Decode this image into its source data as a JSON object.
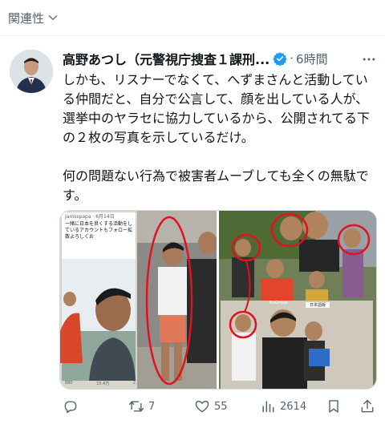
{
  "top": {
    "label": "関連性"
  },
  "tweet": {
    "author_name": "高野あつし（元警視庁捜査１課刑...",
    "time": "6時間",
    "separator": "·",
    "text_paragraph_1": "しかも、リスナーでなくて、へずまさんと活動している仲間だと、自分で公言して、顔を出している人が、選挙中のヤラセに協力しているから、公開されてる下の２枚の写真を示しているだけ。",
    "text_paragraph_2": "何の問題ない行為で被害者ムーブしても全くの無駄です。"
  },
  "photo1": {
    "header_name": "Jamsspapa · 6月14日",
    "header_text": "一緒に日本を良くする活動をしているアカウントもフォロー拡散よろしくお",
    "stats": [
      "880",
      "15.4万",
      "2"
    ]
  },
  "photo2": {
    "shirt_text": "RizGroup",
    "sign_text": "日本語版"
  },
  "actions": {
    "reply_count": "",
    "retweet_count": "7",
    "like_count": "55",
    "views_count": "2614"
  },
  "colors": {
    "accent": "#1d9bf0",
    "muted": "#536471",
    "annotation": "#e0121f"
  },
  "icons": [
    "chevron-down-icon",
    "verified-badge-icon",
    "more-icon",
    "reply-icon",
    "retweet-icon",
    "like-icon",
    "views-icon",
    "bookmark-icon",
    "share-icon"
  ]
}
